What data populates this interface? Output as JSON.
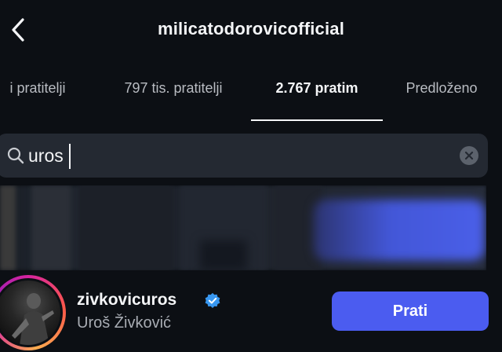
{
  "header": {
    "title": "milicatodorovicofficial",
    "back_icon": "chevron-left-icon"
  },
  "tabs": [
    {
      "label": "i pratitelji",
      "active": false
    },
    {
      "label": "797 tis. pratitelji",
      "active": false
    },
    {
      "label": "2.767 pratim",
      "active": true
    },
    {
      "label": "Predloženo",
      "active": false
    }
  ],
  "search": {
    "value": "uros",
    "icon": "search-icon",
    "clear_icon": "clear-icon"
  },
  "results": {
    "blurred_row_icon": "redacted-content",
    "user": {
      "username": "zivkovicuros",
      "full_name": "Uroš Živković",
      "verified": true,
      "follow_label": "Prati",
      "story_ring": true
    }
  },
  "colors": {
    "background": "#0c0f14",
    "search_bg": "#242932",
    "accent": "#4b5cf0",
    "verified": "#3897f0"
  }
}
